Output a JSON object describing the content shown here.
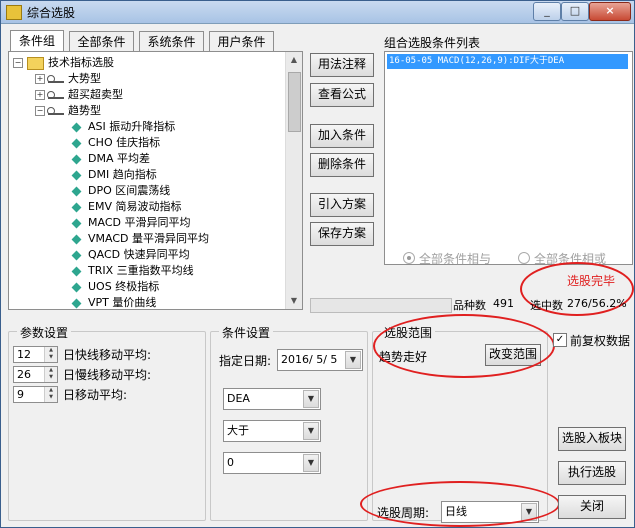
{
  "window": {
    "title": "综合选股",
    "min": "_",
    "max": "□",
    "close": "×"
  },
  "tabs": [
    "条件组",
    "全部条件",
    "系统条件",
    "用户条件"
  ],
  "tree": {
    "root": "技术指标选股",
    "groups": [
      "大势型",
      "超买超卖型",
      "趋势型"
    ],
    "items": [
      "ASI 振动升降指标",
      "CHO 佳庆指标",
      "DMA 平均差",
      "DMI 趋向指标",
      "DPO 区间震荡线",
      "EMV 简易波动指标",
      "MACD 平滑异同平均",
      "VMACD 量平滑异同平均",
      "QACD 快速异同平均",
      "TRIX 三重指数平均线",
      "UOS 终极指标",
      "VPT 量价曲线"
    ]
  },
  "buttons": {
    "usage": "用法注释",
    "formula": "查看公式",
    "add": "加入条件",
    "delete": "删除条件",
    "import": "引入方案",
    "save": "保存方案",
    "change_range": "改变范围",
    "to_sector": "选股入板块",
    "execute": "执行选股",
    "close": "关闭"
  },
  "combo_list": {
    "title": "组合选股条件列表",
    "items": [
      "16-05-05 MACD(12,26,9):DIF大于DEA"
    ]
  },
  "logic": {
    "and": "全部条件相与",
    "or": "全部条件相或"
  },
  "status": {
    "done": "选股完毕",
    "count_label": "品种数",
    "count_value": "491",
    "hit_label": "选中数",
    "hit_value": "276/56.2%"
  },
  "params": {
    "legend": "参数设置",
    "rows": [
      {
        "value": "12",
        "label": "日快线移动平均:"
      },
      {
        "value": "26",
        "label": "日慢线移动平均:"
      },
      {
        "value": "9",
        "label": "日移动平均:"
      }
    ]
  },
  "conditions": {
    "legend": "条件设置",
    "date_label": "指定日期:",
    "date_value": "2016/ 5/ 5",
    "field": "DEA",
    "operator": "大于",
    "value": "0"
  },
  "range": {
    "legend": "选股范围",
    "value": "趋势走好"
  },
  "prev_adjust": {
    "label": "前复权数据",
    "checked": true,
    "mark": "✓"
  },
  "period": {
    "label": "选股周期:",
    "value": "日线"
  },
  "colors": {
    "highlight": "#3399ff",
    "annotation": "#e02020",
    "done_text": "#e02020"
  }
}
